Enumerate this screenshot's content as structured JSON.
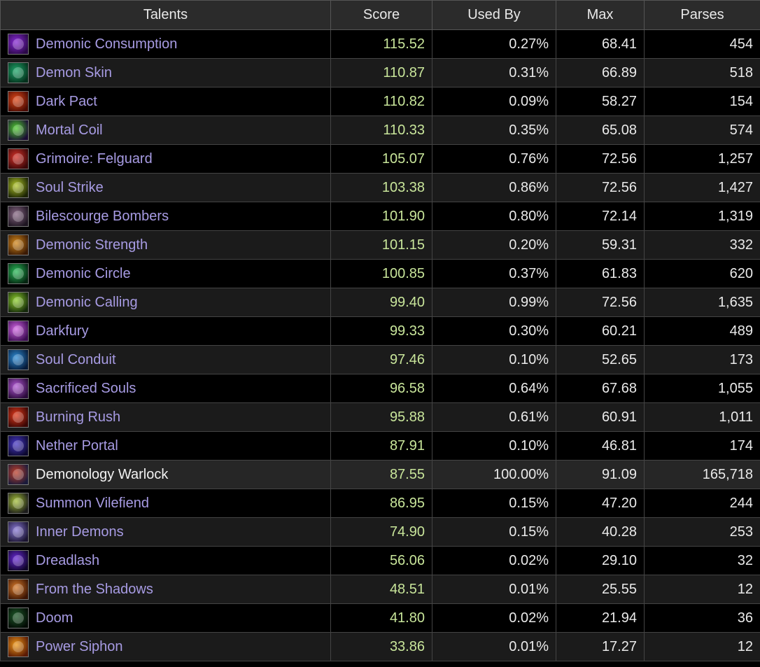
{
  "headers": {
    "talents": "Talents",
    "score": "Score",
    "used_by": "Used By",
    "max": "Max",
    "parses": "Parses"
  },
  "rows": [
    {
      "name": "Demonic Consumption",
      "score": "115.52",
      "used_by": "0.27%",
      "max": "68.41",
      "parses": "454",
      "icon": "skull-icon",
      "color": "#8a2bd8",
      "color2": "#2a0848"
    },
    {
      "name": "Demon Skin",
      "score": "110.87",
      "used_by": "0.31%",
      "max": "66.89",
      "parses": "518",
      "icon": "demon-face-icon",
      "color": "#1fa86b",
      "color2": "#04301c"
    },
    {
      "name": "Dark Pact",
      "score": "110.82",
      "used_by": "0.09%",
      "max": "58.27",
      "parses": "154",
      "icon": "eye-icon",
      "color": "#e0491a",
      "color2": "#4a0a02"
    },
    {
      "name": "Mortal Coil",
      "score": "110.33",
      "used_by": "0.35%",
      "max": "65.08",
      "parses": "574",
      "icon": "coil-icon",
      "color": "#4fcf2e",
      "color2": "#1a0b33"
    },
    {
      "name": "Grimoire: Felguard",
      "score": "105.07",
      "used_by": "0.76%",
      "max": "72.56",
      "parses": "1,257",
      "icon": "crossed-axes-icon",
      "color": "#d8332a",
      "color2": "#3a0708"
    },
    {
      "name": "Soul Strike",
      "score": "103.38",
      "used_by": "0.86%",
      "max": "72.56",
      "parses": "1,427",
      "icon": "blade-icon",
      "color": "#b2c72a",
      "color2": "#1c2404"
    },
    {
      "name": "Bilescourge Bombers",
      "score": "101.90",
      "used_by": "0.80%",
      "max": "72.14",
      "parses": "1,319",
      "icon": "bat-icon",
      "color": "#8a6a86",
      "color2": "#1d1420"
    },
    {
      "name": "Demonic Strength",
      "score": "101.15",
      "used_by": "0.20%",
      "max": "59.31",
      "parses": "332",
      "icon": "horned-demon-icon",
      "color": "#d58a1c",
      "color2": "#3b1a04"
    },
    {
      "name": "Demonic Circle",
      "score": "100.85",
      "used_by": "0.37%",
      "max": "61.83",
      "parses": "620",
      "icon": "circle-rune-icon",
      "color": "#2bbd5a",
      "color2": "#042410"
    },
    {
      "name": "Demonic Calling",
      "score": "99.40",
      "used_by": "0.99%",
      "max": "72.56",
      "parses": "1,635",
      "icon": "imp-face-icon",
      "color": "#8fd12e",
      "color2": "#14280a"
    },
    {
      "name": "Darkfury",
      "score": "99.33",
      "used_by": "0.30%",
      "max": "60.21",
      "parses": "489",
      "icon": "fury-burst-icon",
      "color": "#d466e6",
      "color2": "#3a0b50"
    },
    {
      "name": "Soul Conduit",
      "score": "97.46",
      "used_by": "0.10%",
      "max": "52.65",
      "parses": "173",
      "icon": "swirl-icon",
      "color": "#2f8ed8",
      "color2": "#061a38"
    },
    {
      "name": "Sacrificed Souls",
      "score": "96.58",
      "used_by": "0.64%",
      "max": "67.68",
      "parses": "1,055",
      "icon": "soul-icon",
      "color": "#b45ad8",
      "color2": "#2a0a3a"
    },
    {
      "name": "Burning Rush",
      "score": "95.88",
      "used_by": "0.61%",
      "max": "60.91",
      "parses": "1,011",
      "icon": "flame-runner-icon",
      "color": "#e23a1c",
      "color2": "#3a0604"
    },
    {
      "name": "Nether Portal",
      "score": "87.91",
      "used_by": "0.10%",
      "max": "46.81",
      "parses": "174",
      "icon": "portal-icon",
      "color": "#4a3ac8",
      "color2": "#0c0830"
    },
    {
      "name": "Demonology Warlock",
      "score": "87.55",
      "used_by": "100.00%",
      "max": "91.09",
      "parses": "165,718",
      "icon": "warlock-spec-icon",
      "color": "#c0402a",
      "color2": "#1a1a3a",
      "spec": true
    },
    {
      "name": "Summon Vilefiend",
      "score": "86.95",
      "used_by": "0.15%",
      "max": "47.20",
      "parses": "244",
      "icon": "vilefiend-icon",
      "color": "#a6c23a",
      "color2": "#1a1a1a"
    },
    {
      "name": "Inner Demons",
      "score": "74.90",
      "used_by": "0.15%",
      "max": "40.28",
      "parses": "253",
      "icon": "inner-demon-icon",
      "color": "#8a7ad8",
      "color2": "#1a1430"
    },
    {
      "name": "Dreadlash",
      "score": "56.06",
      "used_by": "0.02%",
      "max": "29.10",
      "parses": "32",
      "icon": "dread-hound-icon",
      "color": "#6a2ad8",
      "color2": "#0e0428"
    },
    {
      "name": "From the Shadows",
      "score": "48.51",
      "used_by": "0.01%",
      "max": "25.55",
      "parses": "12",
      "icon": "shadow-claw-icon",
      "color": "#d87a2a",
      "color2": "#3a1404"
    },
    {
      "name": "Doom",
      "score": "41.80",
      "used_by": "0.02%",
      "max": "21.94",
      "parses": "36",
      "icon": "doom-eyes-icon",
      "color": "#1f5a2a",
      "color2": "#020a04"
    },
    {
      "name": "Power Siphon",
      "score": "33.86",
      "used_by": "0.01%",
      "max": "17.27",
      "parses": "12",
      "icon": "power-siphon-icon",
      "color": "#f09a1a",
      "color2": "#5a1a04"
    }
  ]
}
